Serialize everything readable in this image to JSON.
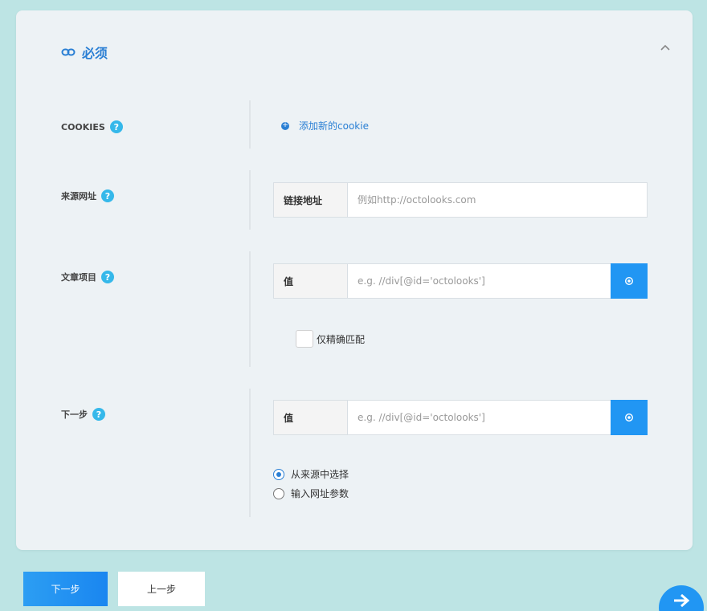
{
  "section": {
    "title": "必须",
    "icon": "link-icon",
    "collapse_icon": "chevron-up-icon"
  },
  "cookies": {
    "label": "COOKIES",
    "add_link": "添加新的cookie",
    "add_icon": "plus-circle-icon"
  },
  "source_url": {
    "label": "来源网址",
    "addon": "链接地址",
    "placeholder": "例如http://octolooks.com",
    "value": ""
  },
  "article_items": {
    "label": "文章项目",
    "addon": "值",
    "placeholder": "e.g. //div[@id='octolooks']",
    "value": "",
    "picker_icon": "target-icon",
    "exact_match_label": "仅精确匹配",
    "exact_match_checked": false
  },
  "next_page": {
    "label": "下一步",
    "addon": "值",
    "placeholder": "e.g. //div[@id='octolooks']",
    "value": "",
    "picker_icon": "target-icon",
    "radio_options": [
      {
        "label": "从来源中选择",
        "checked": true
      },
      {
        "label": "输入网址参数",
        "checked": false
      }
    ]
  },
  "help_icon_glyph": "?",
  "buttons": {
    "next": "下一步",
    "prev": "上一步"
  },
  "fab_icon": "arrow-right-icon",
  "colors": {
    "accent": "#2196f3",
    "link": "#2a7fd4",
    "help": "#35b8ea",
    "background": "#bde4e4",
    "card": "#edf2f5"
  }
}
